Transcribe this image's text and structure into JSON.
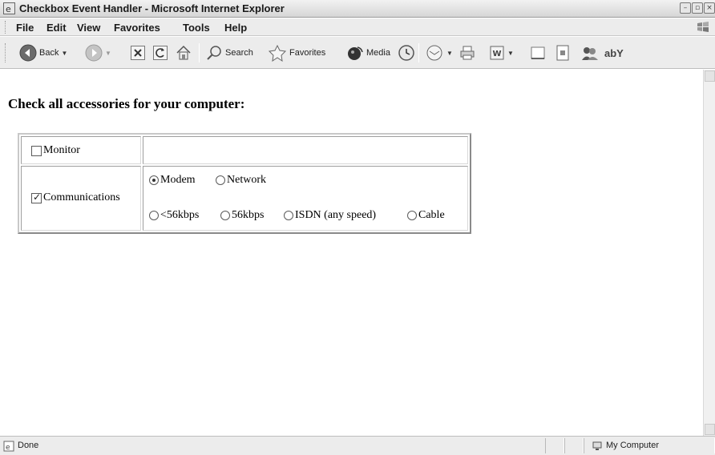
{
  "window": {
    "title": "Checkbox Event Handler - Microsoft Internet Explorer"
  },
  "menu": [
    "File",
    "Edit",
    "View",
    "Favorites",
    "Tools",
    "Help"
  ],
  "toolbar": {
    "back_label": "Back",
    "search_label": "Search",
    "favorites_label": "Favorites",
    "media_label": "Media",
    "aby_label": "abY"
  },
  "page": {
    "heading": "Check all accessories for your computer:",
    "monitor": {
      "label": "Monitor",
      "checked": false
    },
    "communications": {
      "label": "Communications",
      "checked": true
    },
    "connection_types": [
      {
        "label": "Modem",
        "checked": true
      },
      {
        "label": "Network",
        "checked": false
      }
    ],
    "speeds": [
      {
        "label": "<56kbps",
        "checked": false
      },
      {
        "label": "56kbps",
        "checked": false
      },
      {
        "label": "ISDN (any speed)",
        "checked": false
      },
      {
        "label": "Cable",
        "checked": false
      }
    ]
  },
  "status": {
    "text": "Done",
    "zone": "My Computer"
  }
}
